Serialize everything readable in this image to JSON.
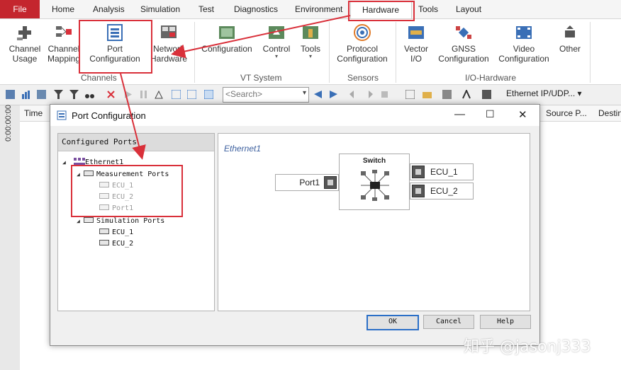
{
  "menu": {
    "file": "File",
    "items": [
      "Home",
      "Analysis",
      "Simulation",
      "Test",
      "Diagnostics",
      "Environment"
    ],
    "active": "Hardware",
    "after": [
      "Tools",
      "Layout"
    ]
  },
  "ribbon": {
    "channels": {
      "label": "Channels",
      "buttons": [
        {
          "l1": "Channel",
          "l2": "Usage"
        },
        {
          "l1": "Channel",
          "l2": "Mapping"
        },
        {
          "l1": "Port",
          "l2": "Configuration"
        },
        {
          "l1": "Network",
          "l2": "Hardware"
        }
      ]
    },
    "vt_system": {
      "label": "VT System",
      "buttons": [
        {
          "l1": "Configuration"
        },
        {
          "l1": "Control"
        },
        {
          "l1": "Tools"
        }
      ]
    },
    "sensors": {
      "label": "Sensors",
      "buttons": [
        {
          "l1": "Protocol",
          "l2": "Configuration"
        }
      ]
    },
    "io_hardware": {
      "label": "I/O-Hardware",
      "buttons": [
        {
          "l1": "Vector",
          "l2": "I/O"
        },
        {
          "l1": "GNSS",
          "l2": "Configuration"
        },
        {
          "l1": "Video",
          "l2": "Configuration"
        },
        {
          "l1": "Other"
        }
      ]
    }
  },
  "toolbar": {
    "search_placeholder": "<Search>",
    "ethernet_selector": "Ethernet IP/UDP..."
  },
  "background": {
    "vertical_time": "0:00:00:00",
    "time_col": "Time",
    "source_col": "Source P...",
    "dest_col": "Destin"
  },
  "dialog": {
    "title": "Port Configuration",
    "configured_ports_header": "Configured Ports",
    "tree": {
      "root": "Ethernet1",
      "measurement": {
        "label": "Measurement Ports",
        "children": [
          "ECU_1",
          "ECU_2",
          "Port1"
        ]
      },
      "simulation": {
        "label": "Simulation Ports",
        "children": [
          "ECU_1",
          "ECU_2"
        ]
      }
    },
    "network_title": "Ethernet1",
    "switch_label": "Switch",
    "port_left": "Port1",
    "ports_right": [
      "ECU_1",
      "ECU_2"
    ],
    "buttons": {
      "ok": "OK",
      "cancel": "Cancel",
      "help": "Help"
    }
  },
  "watermark": "知乎 @jasonj333",
  "colors": {
    "accent_red": "#d9303a",
    "file_bg": "#c4262e",
    "ok_border": "#2b6fc7"
  }
}
